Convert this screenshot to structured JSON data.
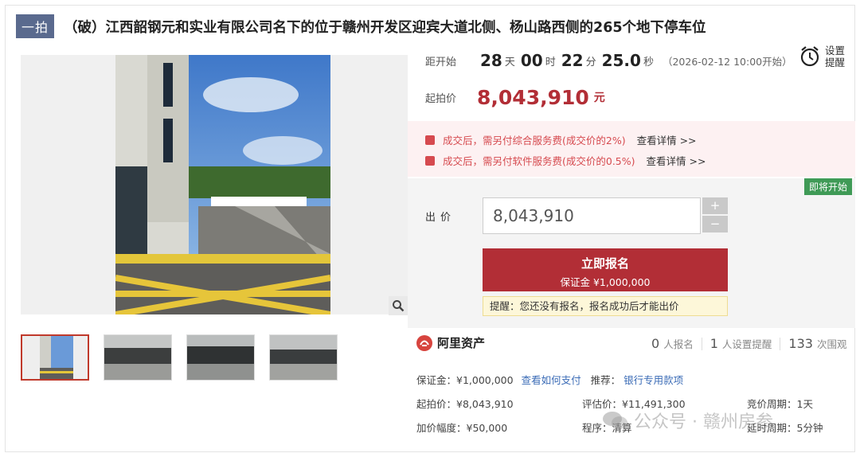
{
  "header": {
    "badge": "一拍",
    "title": "（破）江西韶钢元和实业有限公司名下的位于赣州开发区迎宾大道北侧、杨山路西侧的265个地下停车位"
  },
  "countdown": {
    "label": "距开始",
    "days": "28",
    "days_unit": "天",
    "hours": "00",
    "hours_unit": "时",
    "minutes": "22",
    "minutes_unit": "分",
    "seconds": "25.0",
    "seconds_unit": "秒",
    "start_note": "（2026-02-12 10:00开始）"
  },
  "reminder": {
    "line1": "设置",
    "line2": "提醒",
    "icon": "alarm-clock-icon"
  },
  "start_price": {
    "label": "起拍价",
    "value": "8,043,910",
    "unit": "元"
  },
  "fees": [
    {
      "text": "成交后，需另付综合服务费(成交价的2%)",
      "link": "查看详情 >>"
    },
    {
      "text": "成交后，需另付软件服务费(成交价的0.5%)",
      "link": "查看详情 >>"
    }
  ],
  "bid": {
    "status": "即将开始",
    "label": "出价",
    "input_value": "8,043,910",
    "plus": "+",
    "minus": "−",
    "register_label": "立即报名",
    "deposit_label": "保证金 ¥1,000,000",
    "tip": "提醒：您还没有报名，报名成功后才能出价"
  },
  "brand": {
    "name": "阿里资产"
  },
  "stats": [
    {
      "num": "0",
      "label": "人报名"
    },
    {
      "num": "1",
      "label": "人设置提醒"
    },
    {
      "num": "133",
      "label": "次围观"
    }
  ],
  "info": {
    "deposit": "保证金：¥1,000,000",
    "how_to_pay": "查看如何支付",
    "recommend_label": "推荐：",
    "recommend_value": "银行专用款项",
    "start_price": "起拍价：¥8,043,910",
    "eval_price": "评估价：¥11,491,300",
    "cycle": "竞价周期：1天",
    "increment": "加价幅度：¥50,000",
    "procedure": "程序：清算",
    "delay": "延时周期：5分钟"
  },
  "watermark": "公众号 · 赣州房参",
  "colors": {
    "accent_red": "#b22e36",
    "badge_blue": "#5a6a8e",
    "status_green": "#3f9a56",
    "link_blue": "#3a6bb6"
  }
}
